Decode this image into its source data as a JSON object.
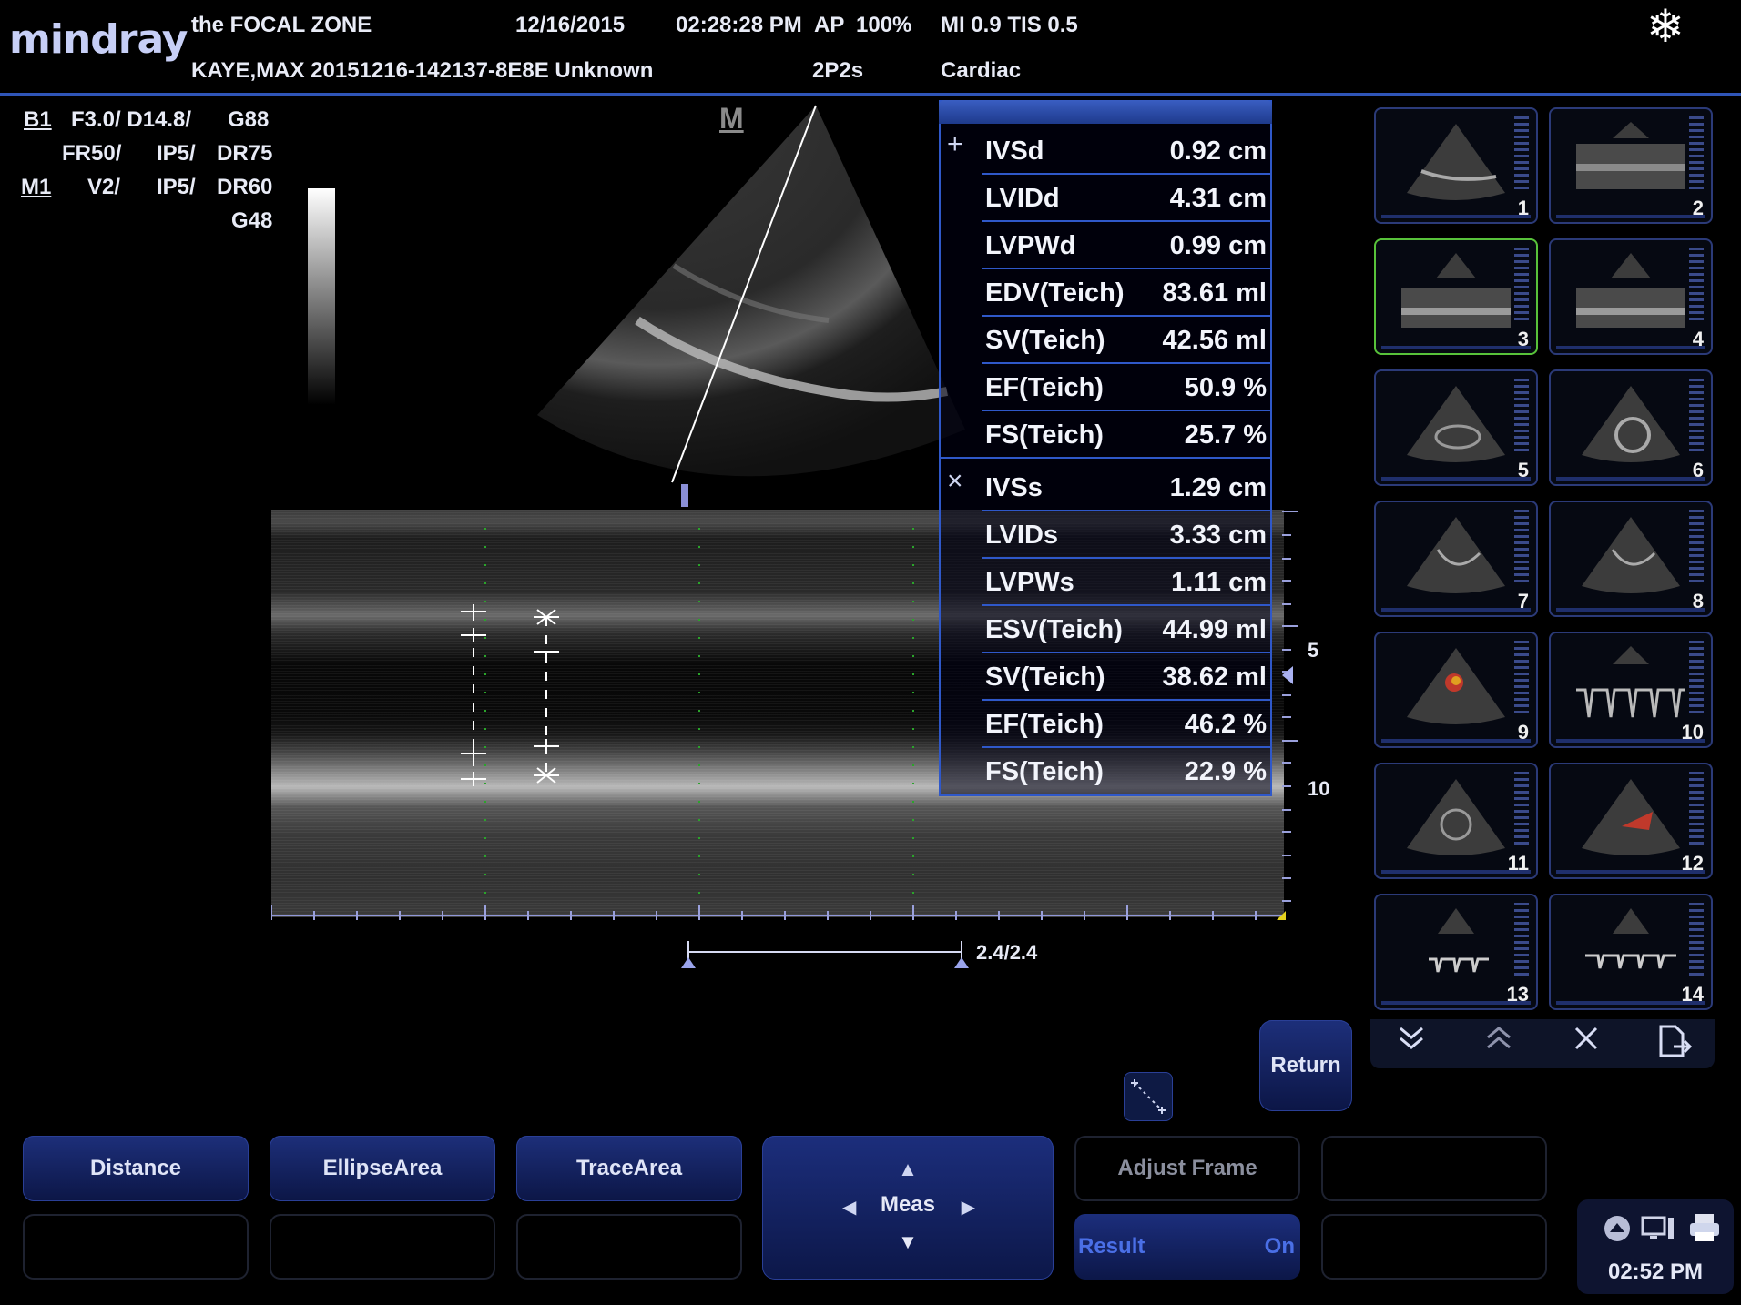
{
  "header": {
    "brand": "mindray",
    "facility": "the FOCAL ZONE",
    "date": "12/16/2015",
    "time": "02:28:28 PM",
    "ap_label": "AP",
    "ap_value": "100%",
    "mi_tis": "MI 0.9 TIS 0.5",
    "patient": "KAYE,MAX 20151216-142137-8E8E Unknown",
    "probe": "2P2s",
    "exam": "Cardiac",
    "freeze_icon": "snowflake-icon"
  },
  "params": {
    "b_mode": "B1",
    "b_line1": "F3.0/ D14.8/",
    "b_gain": "G88",
    "b_fr": "FR50/",
    "b_ip": "IP5/",
    "b_dr": "DR75",
    "m_mode": "M1",
    "m_v": "V2/",
    "m_ip": "IP5/",
    "m_dr": "DR60",
    "m_gain": "G48"
  },
  "image": {
    "mode_label": "M",
    "depth_marks": [
      "5",
      "10"
    ],
    "sweep_speed": "2.4/2.4"
  },
  "measurements": {
    "diastole": [
      {
        "name": "IVSd",
        "value": "0.92 cm"
      },
      {
        "name": "LVIDd",
        "value": "4.31 cm"
      },
      {
        "name": "LVPWd",
        "value": "0.99 cm"
      },
      {
        "name": "EDV(Teich)",
        "value": "83.61 ml"
      },
      {
        "name": "SV(Teich)",
        "value": "42.56 ml"
      },
      {
        "name": "EF(Teich)",
        "value": "50.9 %"
      },
      {
        "name": "FS(Teich)",
        "value": "25.7 %"
      }
    ],
    "systole": [
      {
        "name": "IVSs",
        "value": "1.29 cm"
      },
      {
        "name": "LVIDs",
        "value": "3.33 cm"
      },
      {
        "name": "LVPWs",
        "value": "1.11 cm"
      },
      {
        "name": "ESV(Teich)",
        "value": "44.99 ml"
      },
      {
        "name": "SV(Teich)",
        "value": "38.62 ml"
      },
      {
        "name": "EF(Teich)",
        "value": "46.2 %"
      },
      {
        "name": "FS(Teich)",
        "value": "22.9 %"
      }
    ],
    "diastole_marker": "+",
    "systole_marker": "×"
  },
  "thumbnails": [
    "1",
    "2",
    "3",
    "4",
    "5",
    "6",
    "7",
    "8",
    "9",
    "10",
    "11",
    "12",
    "13",
    "14"
  ],
  "thumb_toolbar": {
    "page_down_icon": "double-chevron-down-icon",
    "page_up_icon": "double-chevron-up-icon",
    "delete_icon": "close-icon",
    "export_icon": "export-file-icon"
  },
  "buttons": {
    "distance": "Distance",
    "ellipse_area": "EllipseArea",
    "trace_area": "TraceArea",
    "meas": "Meas",
    "adjust_frame": "Adjust Frame",
    "result": "Result",
    "result_state": "On",
    "return": "Return"
  },
  "status": {
    "time": "02:52 PM"
  }
}
